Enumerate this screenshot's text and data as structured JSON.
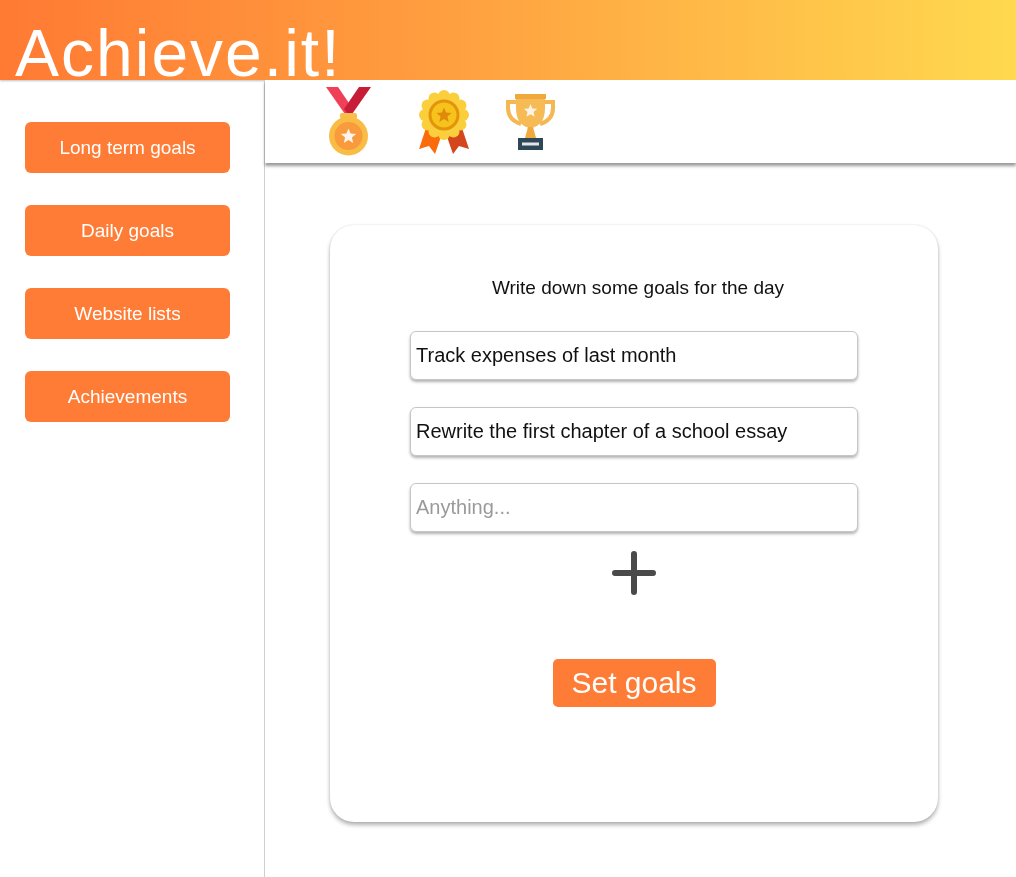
{
  "app": {
    "title": "Achieve.it!"
  },
  "sidebar": {
    "items": [
      {
        "label": "Long term goals"
      },
      {
        "label": "Daily goals"
      },
      {
        "label": "Website lists"
      },
      {
        "label": "Achievements"
      }
    ]
  },
  "badges": [
    {
      "kind": "medal"
    },
    {
      "kind": "rosette"
    },
    {
      "kind": "trophy"
    }
  ],
  "goal_card": {
    "heading": "Write down some goals for the day",
    "goals": [
      {
        "value": "Track expenses of last month"
      },
      {
        "value": "Rewrite the first chapter of a school essay"
      },
      {
        "placeholder": "Anything..."
      }
    ],
    "submit_label": "Set goals"
  }
}
